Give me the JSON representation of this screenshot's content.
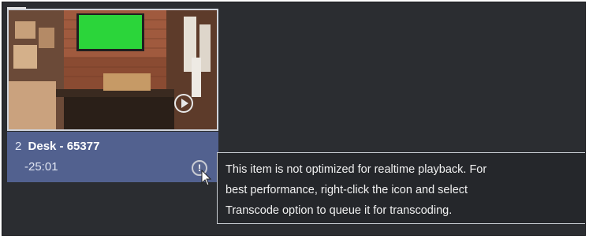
{
  "clip": {
    "index": "2",
    "title": "Desk - 65377",
    "duration": "-25:01",
    "info_icon": "!",
    "colors": {
      "panel_bg": "#2b2d31",
      "selected_bg": "#52618f",
      "green_screen": "#2bd53a"
    }
  },
  "tooltip": {
    "lines": [
      "This item is not optimized for realtime playback. For",
      "best performance, right-click the icon and select",
      "Transcode option to queue it for transcoding."
    ]
  },
  "icons": {
    "thumbnail_overlay": "play-circle-icon",
    "info": "info-icon",
    "cursor": "mouse-pointer-icon"
  }
}
